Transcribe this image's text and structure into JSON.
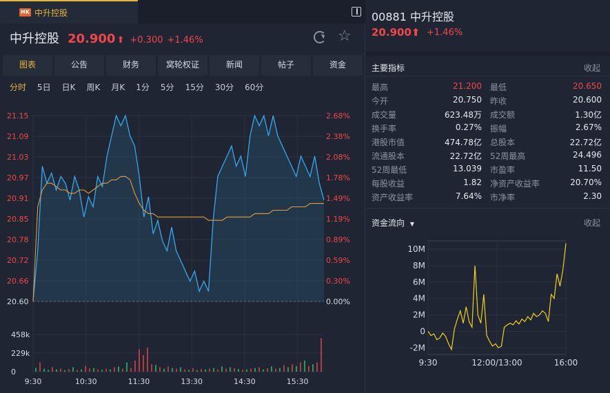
{
  "tab": {
    "badge": "HK",
    "name": "中升控股"
  },
  "quote": {
    "name": "中升控股",
    "price": "20.900",
    "arrow": "⬆",
    "change": "+0.300",
    "pct": "+1.46%"
  },
  "nav_tabs": [
    "图表",
    "公告",
    "财务",
    "窝轮权证",
    "新闻",
    "帖子",
    "资金"
  ],
  "periods": [
    "分时",
    "5日",
    "日K",
    "周K",
    "月K",
    "1分",
    "5分",
    "15分",
    "30分",
    "60分"
  ],
  "right": {
    "code_name": "00881 中升控股",
    "price": "20.900⬆",
    "pct": "+1.46%"
  },
  "metrics_section": {
    "title": "主要指标",
    "collapse": "收起"
  },
  "metrics": [
    {
      "l1": "最高",
      "v1": "21.200",
      "l2": "最低",
      "v2": "20.650",
      "v1red": true,
      "v2red": true
    },
    {
      "l1": "今开",
      "v1": "20.750",
      "l2": "昨收",
      "v2": "20.600"
    },
    {
      "l1": "成交量",
      "v1": "623.48万",
      "l2": "成交额",
      "v2": "1.30亿"
    },
    {
      "l1": "换手率",
      "v1": "0.27%",
      "l2": "振幅",
      "v2": "2.67%"
    },
    {
      "l1": "港股市值",
      "v1": "474.78亿",
      "l2": "总股本",
      "v2": "22.72亿"
    },
    {
      "l1": "流通股本",
      "v1": "22.72亿",
      "l2": "52周最高",
      "v2": "24.496"
    },
    {
      "l1": "52周最低",
      "v1": "13.039",
      "l2": "市盈率",
      "v2": "11.50"
    },
    {
      "l1": "每股收益",
      "v1": "1.82",
      "l2": "净资产收益率",
      "v2": "20.70%"
    },
    {
      "l1": "资产收益率",
      "v1": "7.64%",
      "l2": "市净率",
      "v2": "2.30"
    }
  ],
  "flow_section": {
    "title": "资金流向",
    "collapse": "收起"
  },
  "colors": {
    "accent": "#e8b53b",
    "up": "#f04848",
    "down": "#2ecc71",
    "price_line": "#35a9f0",
    "avg_line": "#e89a3c",
    "flow_line": "#f2d21b"
  },
  "chart_data": [
    {
      "type": "line",
      "title": "分时",
      "y_ticks_left": [
        "21.15",
        "21.09",
        "21.03",
        "20.97",
        "20.91",
        "20.85",
        "20.78",
        "20.72",
        "20.66",
        "20.60"
      ],
      "y_ticks_right": [
        "2.68%",
        "2.38%",
        "2.08%",
        "1.78%",
        "1.49%",
        "1.19%",
        "0.89%",
        "0.59%",
        "0.30%",
        "0.00%"
      ],
      "ylim": [
        20.6,
        21.15
      ],
      "base_price": 20.6,
      "x_ticks": [
        "9:30",
        "10:30",
        "11:30",
        "13:30",
        "14:30",
        "15:30"
      ],
      "series": [
        {
          "name": "price",
          "values": [
            20.6,
            20.75,
            21.0,
            20.95,
            20.98,
            20.93,
            20.97,
            20.95,
            20.9,
            20.97,
            20.93,
            20.85,
            20.91,
            20.88,
            20.97,
            20.94,
            21.03,
            21.09,
            21.15,
            21.12,
            21.15,
            21.09,
            21.06,
            20.97,
            20.85,
            20.91,
            20.8,
            20.84,
            20.78,
            20.75,
            20.82,
            20.75,
            20.72,
            20.69,
            20.66,
            20.69,
            20.63,
            20.66,
            20.63,
            20.84,
            20.97,
            21.0,
            21.03,
            21.06,
            21.0,
            21.03,
            20.97,
            21.09,
            21.15,
            21.12,
            21.15,
            21.09,
            21.15,
            21.09,
            21.06,
            21.03,
            21.0,
            20.97,
            21.03,
            21.0,
            20.97,
            21.03,
            20.95,
            20.9
          ]
        },
        {
          "name": "avg",
          "values": [
            20.6,
            20.88,
            20.93,
            20.95,
            20.95,
            20.94,
            20.93,
            20.93,
            20.92,
            20.92,
            20.93,
            20.93,
            20.92,
            20.93,
            20.94,
            20.95,
            20.95,
            20.96,
            20.96,
            20.97,
            20.97,
            20.96,
            20.92,
            20.89,
            20.87,
            20.86,
            20.86,
            20.85,
            20.85,
            20.85,
            20.85,
            20.85,
            20.85,
            20.85,
            20.85,
            20.85,
            20.85,
            20.85,
            20.84,
            20.84,
            20.84,
            20.84,
            20.85,
            20.85,
            20.85,
            20.85,
            20.85,
            20.85,
            20.86,
            20.86,
            20.86,
            20.86,
            20.87,
            20.87,
            20.87,
            20.87,
            20.88,
            20.88,
            20.88,
            20.88,
            20.89,
            20.89,
            20.89,
            20.89
          ]
        }
      ]
    },
    {
      "type": "bar",
      "title": "成交量",
      "y_ticks": [
        "458k",
        "229k",
        "0"
      ],
      "ylim": [
        0,
        458000
      ],
      "values": [
        10,
        25,
        8,
        5,
        12,
        6,
        8,
        4,
        7,
        12,
        5,
        6,
        15,
        9,
        10,
        6,
        5,
        8,
        6,
        12,
        14,
        8,
        25,
        10,
        30,
        60,
        45,
        65,
        20,
        18,
        12,
        8,
        14,
        10,
        8,
        12,
        6,
        5,
        9,
        4,
        7,
        6,
        8,
        10,
        6,
        14,
        8,
        12,
        9,
        7,
        5,
        6,
        8,
        10,
        12,
        6,
        9,
        14,
        8,
        10,
        18,
        12,
        20,
        15,
        25,
        30,
        15,
        20,
        25,
        90
      ],
      "colors": [
        "g",
        "r",
        "g",
        "g",
        "r",
        "g",
        "r",
        "g",
        "r",
        "g",
        "r",
        "g",
        "r",
        "r",
        "g",
        "r",
        "g",
        "r",
        "g",
        "r",
        "g",
        "r",
        "g",
        "r",
        "r",
        "r",
        "r",
        "r",
        "r",
        "g",
        "r",
        "g",
        "r",
        "g",
        "r",
        "g",
        "r",
        "g",
        "r",
        "g",
        "r",
        "g",
        "r",
        "g",
        "r",
        "g",
        "r",
        "g",
        "r",
        "g",
        "r",
        "g",
        "r",
        "g",
        "r",
        "g",
        "r",
        "g",
        "r",
        "g",
        "r",
        "g",
        "r",
        "g",
        "r",
        "g",
        "r",
        "g",
        "r",
        "r"
      ]
    },
    {
      "type": "line",
      "title": "资金流向",
      "y_ticks": [
        "10M",
        "8M",
        "6M",
        "4M",
        "2M",
        "0",
        "-2M"
      ],
      "ylim": [
        -2.8,
        11
      ],
      "x_ticks": [
        "9:30",
        "12:00/13:00",
        "16:00"
      ],
      "series": [
        {
          "name": "net",
          "values": [
            0,
            -0.5,
            -0.3,
            -1.0,
            -0.8,
            -0.2,
            -0.6,
            -1.5,
            -2.2,
            0.3,
            1.5,
            2.5,
            1.0,
            3.0,
            1.2,
            0.5,
            8.0,
            2.0,
            1.0,
            4.5,
            -0.5,
            -1.2,
            -1.8,
            -1.5,
            -2.0,
            -1.8,
            0.5,
            0.8,
            1.0,
            0.8,
            1.3,
            0.9,
            1.5,
            1.2,
            1.8,
            1.4,
            2.2,
            1.8,
            2.0,
            2.5,
            2.2,
            1.2,
            4.5,
            4.0,
            7.0,
            5.5,
            7.5,
            10.7
          ]
        }
      ]
    }
  ]
}
